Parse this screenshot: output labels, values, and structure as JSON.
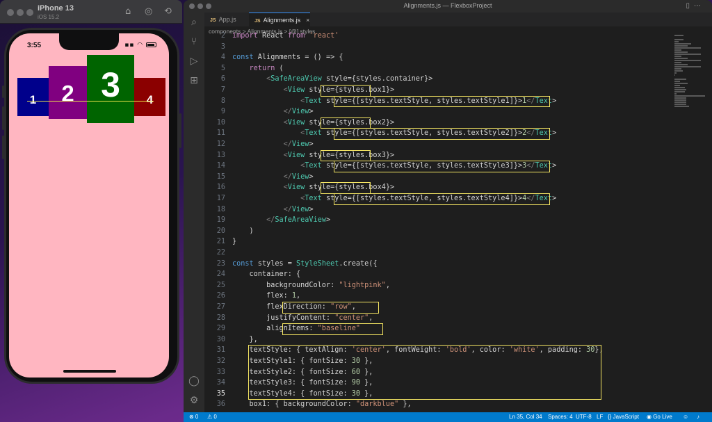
{
  "simulator": {
    "device_name": "iPhone 13",
    "ios_version": "iOS 15.2",
    "status_time": "3:55",
    "screen_bg": "#ffb6c1",
    "boxes": [
      {
        "label": "1",
        "color": "#00008b"
      },
      {
        "label": "2",
        "color": "#800080"
      },
      {
        "label": "3",
        "color": "#006400"
      },
      {
        "label": "4",
        "color": "#8b0000"
      }
    ]
  },
  "editor": {
    "window_title": "Alignments.js — FlexboxProject",
    "tabs": [
      {
        "label": "App.js",
        "badge": "JS"
      },
      {
        "label": "Alignments.js",
        "badge": "JS",
        "close": "×"
      }
    ],
    "breadcrumb": [
      "components",
      ">",
      "Alignments.js",
      ">",
      "[@] styles"
    ],
    "current_line": "35",
    "code_lines": [
      {
        "n": "2",
        "t": "import React from 'react'"
      },
      {
        "n": "3",
        "t": ""
      },
      {
        "n": "4",
        "t": "const Alignments = () => {"
      },
      {
        "n": "5",
        "t": "    return ("
      },
      {
        "n": "6",
        "t": "        <SafeAreaView style={styles.container}>"
      },
      {
        "n": "7",
        "t": "            <View style={styles.box1}>"
      },
      {
        "n": "8",
        "t": "                <Text style={[styles.textStyle, styles.textStyle1]}>1</Text>"
      },
      {
        "n": "9",
        "t": "            </View>"
      },
      {
        "n": "10",
        "t": "            <View style={styles.box2}>"
      },
      {
        "n": "11",
        "t": "                <Text style={[styles.textStyle, styles.textStyle2]}>2</Text>"
      },
      {
        "n": "12",
        "t": "            </View>"
      },
      {
        "n": "13",
        "t": "            <View style={styles.box3}>"
      },
      {
        "n": "14",
        "t": "                <Text style={[styles.textStyle, styles.textStyle3]}>3</Text>"
      },
      {
        "n": "15",
        "t": "            </View>"
      },
      {
        "n": "16",
        "t": "            <View style={styles.box4}>"
      },
      {
        "n": "17",
        "t": "                <Text style={[styles.textStyle, styles.textStyle4]}>4</Text>"
      },
      {
        "n": "18",
        "t": "            </View>"
      },
      {
        "n": "19",
        "t": "        </SafeAreaView>"
      },
      {
        "n": "20",
        "t": "    )"
      },
      {
        "n": "21",
        "t": "}"
      },
      {
        "n": "22",
        "t": ""
      },
      {
        "n": "23",
        "t": "const styles = StyleSheet.create({"
      },
      {
        "n": "24",
        "t": "    container: {"
      },
      {
        "n": "25",
        "t": "        backgroundColor: \"lightpink\","
      },
      {
        "n": "26",
        "t": "        flex: 1,"
      },
      {
        "n": "27",
        "t": "        flexDirection: \"row\","
      },
      {
        "n": "28",
        "t": "        justifyContent: \"center\","
      },
      {
        "n": "29",
        "t": "        alignItems: \"baseline\""
      },
      {
        "n": "30",
        "t": "    },"
      },
      {
        "n": "31",
        "t": "    textStyle: { textAlign: 'center', fontWeight: 'bold', color: 'white', padding: 30},"
      },
      {
        "n": "32",
        "t": "    textStyle1: { fontSize: 30 },"
      },
      {
        "n": "33",
        "t": "    textStyle2: { fontSize: 60 },"
      },
      {
        "n": "34",
        "t": "    textStyle3: { fontSize: 90 },"
      },
      {
        "n": "35",
        "t": "    textStyle4: { fontSize: 30 },"
      },
      {
        "n": "36",
        "t": "    box1: { backgroundColor: \"darkblue\" },"
      }
    ]
  },
  "statusbar": {
    "errors": "⊗ 0",
    "warnings": "⚠ 0",
    "position": "Ln 35, Col 34",
    "spaces": "Spaces: 4",
    "encoding": "UTF-8",
    "eol": "LF",
    "language": "{} JavaScript",
    "golive": "Go Live"
  },
  "colors": {
    "highlight": "#f5e663",
    "accent": "#007acc"
  }
}
